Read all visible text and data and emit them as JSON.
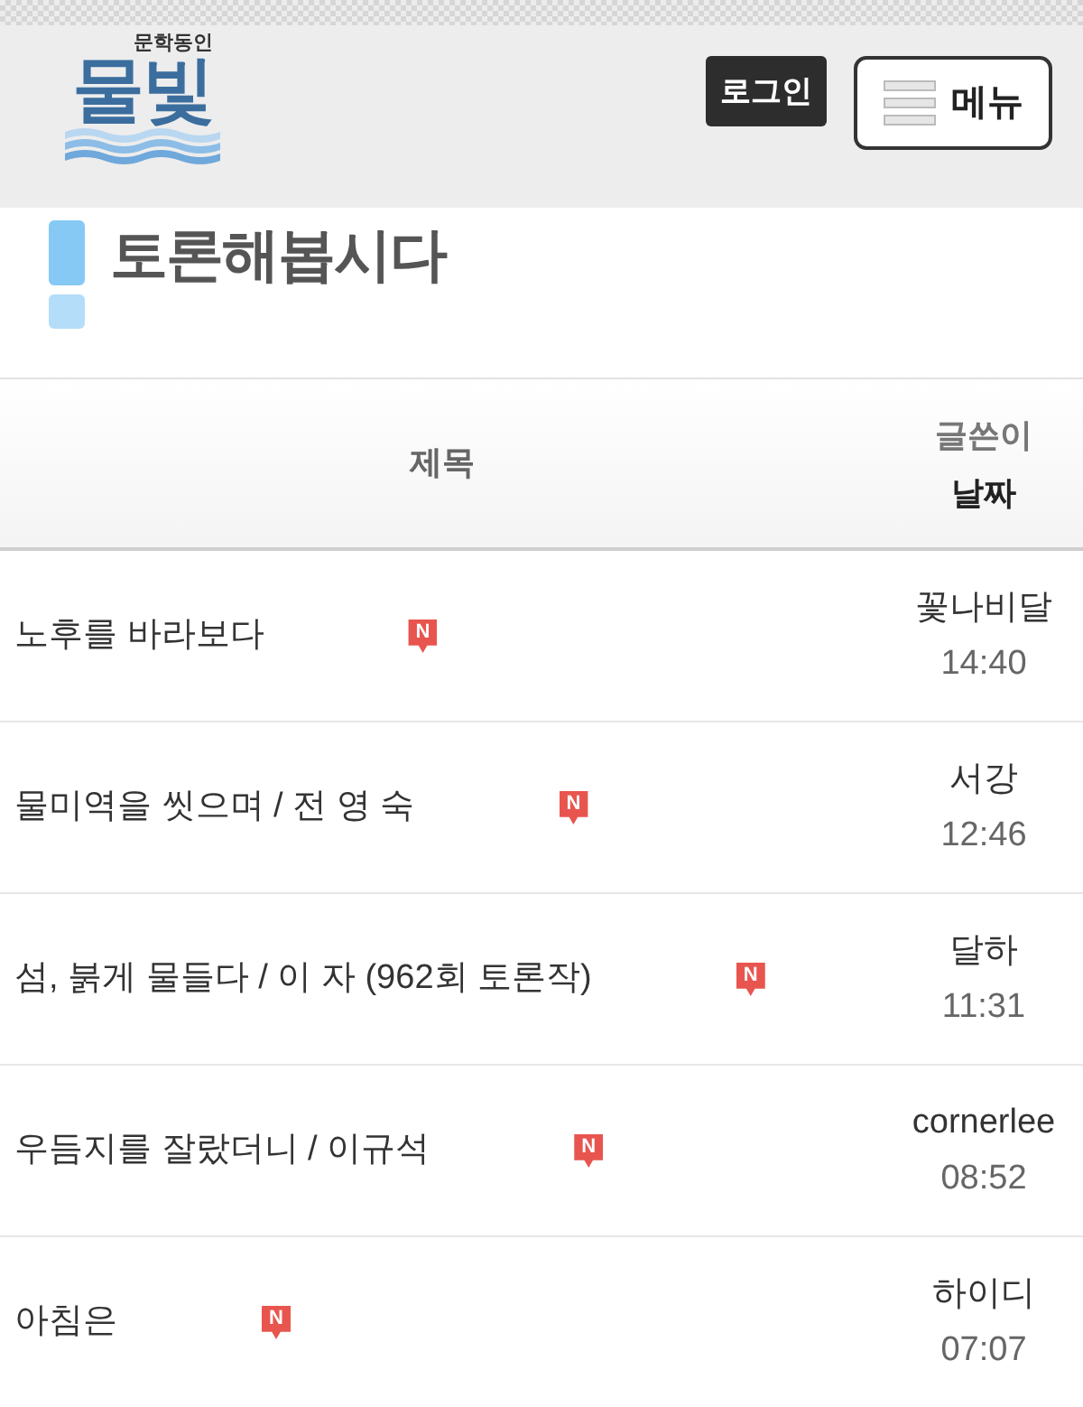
{
  "header": {
    "logo": {
      "tagline": "문학동인",
      "name": "물빛"
    },
    "login_button": "로그인",
    "menu_button": "메뉴"
  },
  "board": {
    "title": "토론해봅시다"
  },
  "table": {
    "columns": {
      "title": "제목",
      "author": "글쓴이",
      "date": "날짜"
    },
    "rows": [
      {
        "title": "노후를 바라보다",
        "badge": "N",
        "author": "꽃나비달",
        "time": "14:40"
      },
      {
        "title": "물미역을 씻으며 / 전 영 숙",
        "badge": "N",
        "author": "서강",
        "time": "12:46"
      },
      {
        "title": "섬, 붉게 물들다 / 이 자 (962회 토론작)",
        "badge": "N",
        "author": "달하",
        "time": "11:31"
      },
      {
        "title": "우듬지를 잘랐더니 / 이규석",
        "badge": "N",
        "author": "cornerlee",
        "time": "08:52"
      },
      {
        "title": "아침은",
        "badge": "N",
        "author": "하이디",
        "time": "07:07"
      }
    ]
  }
}
